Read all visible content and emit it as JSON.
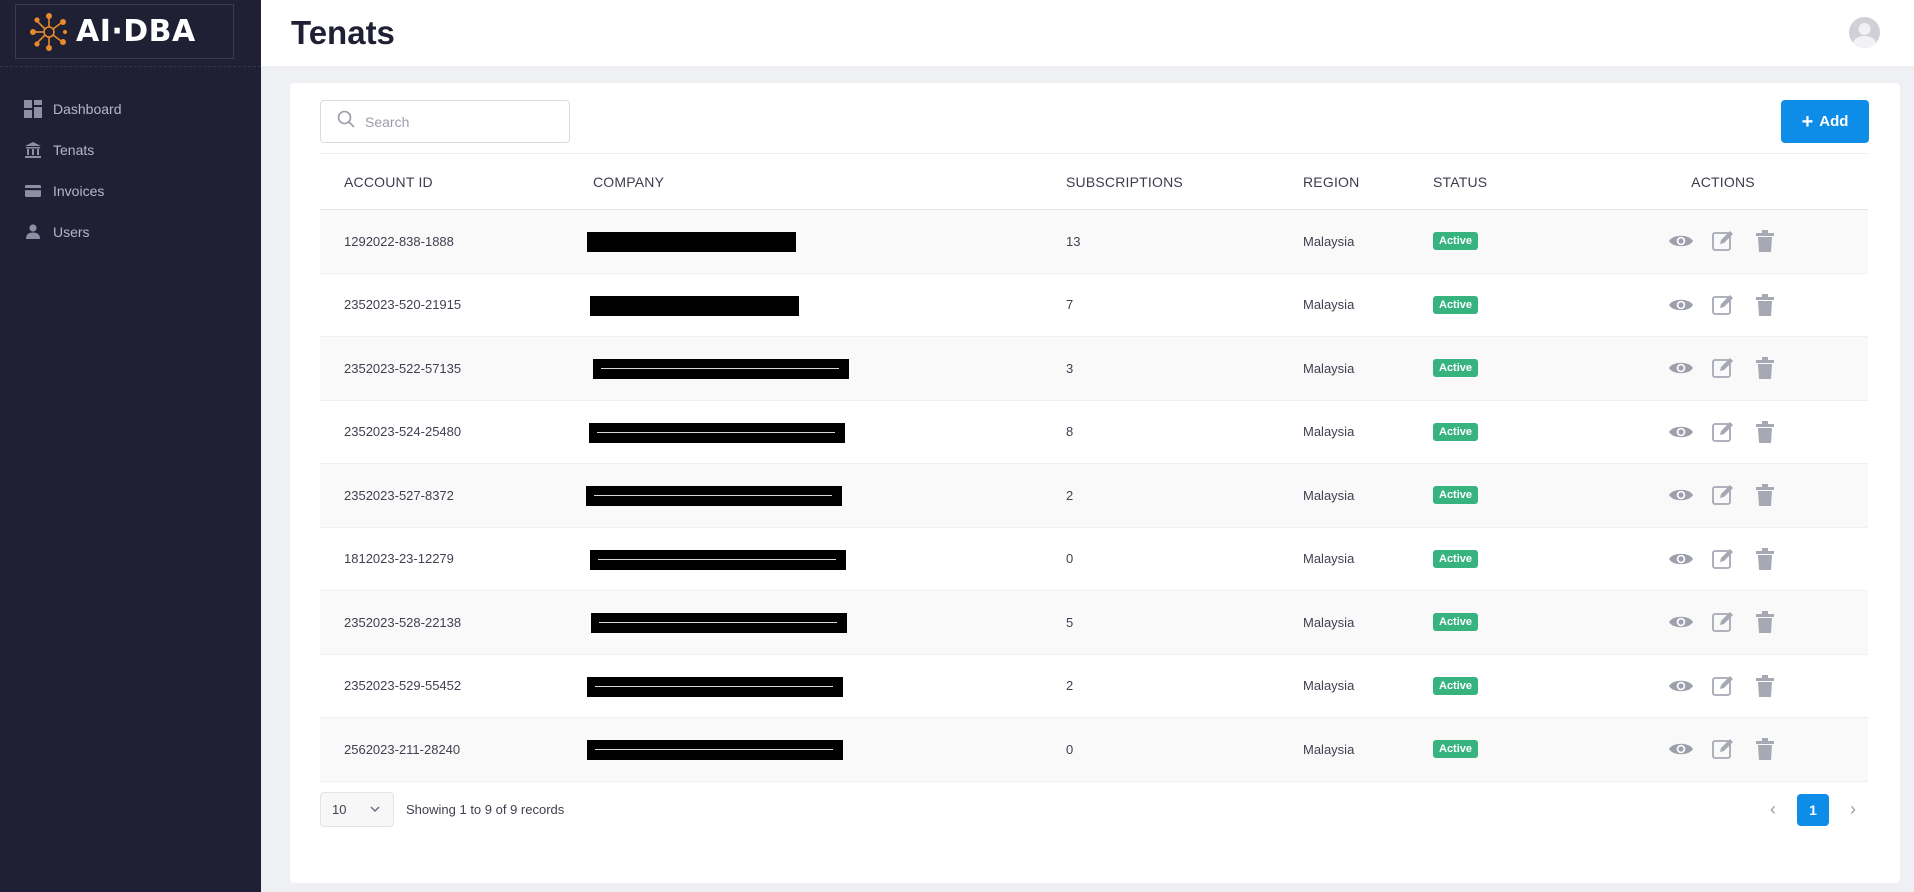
{
  "brand": {
    "logo_text": "AI·DBA",
    "accent_color": "#e8892b"
  },
  "sidebar": {
    "items": [
      {
        "label": "Dashboard",
        "icon": "dashboard-icon"
      },
      {
        "label": "Tenats",
        "icon": "bank-icon"
      },
      {
        "label": "Invoices",
        "icon": "credit-card-icon"
      },
      {
        "label": "Users",
        "icon": "user-icon"
      }
    ]
  },
  "header": {
    "title": "Tenats",
    "avatar_icon": "user-avatar-icon"
  },
  "toolbar": {
    "search_placeholder": "Search",
    "add_label": "Add"
  },
  "table": {
    "columns": [
      "ACCOUNT ID",
      "COMPANY",
      "SUBSCRIPTIONS",
      "REGION",
      "STATUS",
      "ACTIONS"
    ],
    "rows": [
      {
        "account_id": "1292022-838-1888",
        "company": "[redacted]",
        "subscriptions": "13",
        "region": "Malaysia",
        "status": "Active"
      },
      {
        "account_id": "2352023-520-21915",
        "company": "[redacted]",
        "subscriptions": "7",
        "region": "Malaysia",
        "status": "Active"
      },
      {
        "account_id": "2352023-522-57135",
        "company": "[redacted]",
        "subscriptions": "3",
        "region": "Malaysia",
        "status": "Active"
      },
      {
        "account_id": "2352023-524-25480",
        "company": "[redacted]",
        "subscriptions": "8",
        "region": "Malaysia",
        "status": "Active"
      },
      {
        "account_id": "2352023-527-8372",
        "company": "[redacted]",
        "subscriptions": "2",
        "region": "Malaysia",
        "status": "Active"
      },
      {
        "account_id": "1812023-23-12279",
        "company": "[redacted]",
        "subscriptions": "0",
        "region": "Malaysia",
        "status": "Active"
      },
      {
        "account_id": "2352023-528-22138",
        "company": "[redacted]",
        "subscriptions": "5",
        "region": "Malaysia",
        "status": "Active"
      },
      {
        "account_id": "2352023-529-55452",
        "company": "[redacted]",
        "subscriptions": "2",
        "region": "Malaysia",
        "status": "Active"
      },
      {
        "account_id": "2562023-211-28240",
        "company": "[redacted]",
        "subscriptions": "0",
        "region": "Malaysia",
        "status": "Active"
      }
    ],
    "action_icons": [
      "eye-icon",
      "edit-icon",
      "trash-icon"
    ]
  },
  "footer": {
    "per_page": "10",
    "showing_text": "Showing 1 to 9 of 9 records",
    "current_page": "1"
  },
  "colors": {
    "sidebar_bg": "#1f2033",
    "primary": "#0d8ce8",
    "active_badge": "#36b37e"
  }
}
